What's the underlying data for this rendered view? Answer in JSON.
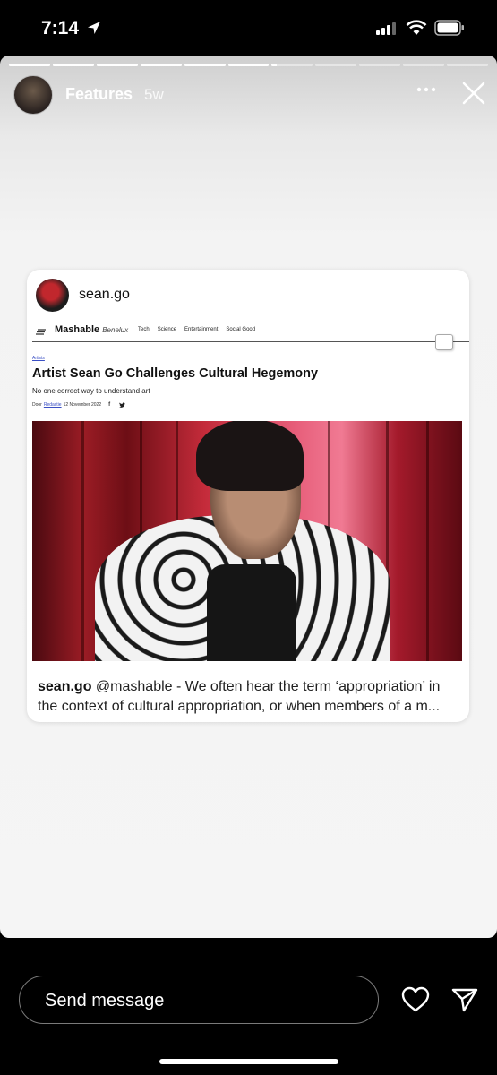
{
  "status_bar": {
    "time": "7:14"
  },
  "story": {
    "progress": {
      "segments": 11,
      "completed": 6,
      "current_fraction": 0.12
    },
    "account_name": "Features",
    "age": "5w"
  },
  "post": {
    "username": "sean.go",
    "article": {
      "brand": "Mashable",
      "brand_region": "Benelux",
      "nav": [
        "Tech",
        "Science",
        "Entertainment",
        "Social Good"
      ],
      "category": "Artists",
      "headline": "Artist Sean Go Challenges Cultural Hegemony",
      "subheadline": "No one correct way to understand art",
      "byline_prefix": "Door",
      "byline_author": "Redactie",
      "byline_date": "12 November 2022"
    },
    "caption_username": "sean.go",
    "caption_line1": "@mashable - We often hear the term ‘appropriation’ in",
    "caption_line2": "the context of cultural appropriation, or when members of a m..."
  },
  "footer": {
    "message_placeholder": "Send message"
  }
}
